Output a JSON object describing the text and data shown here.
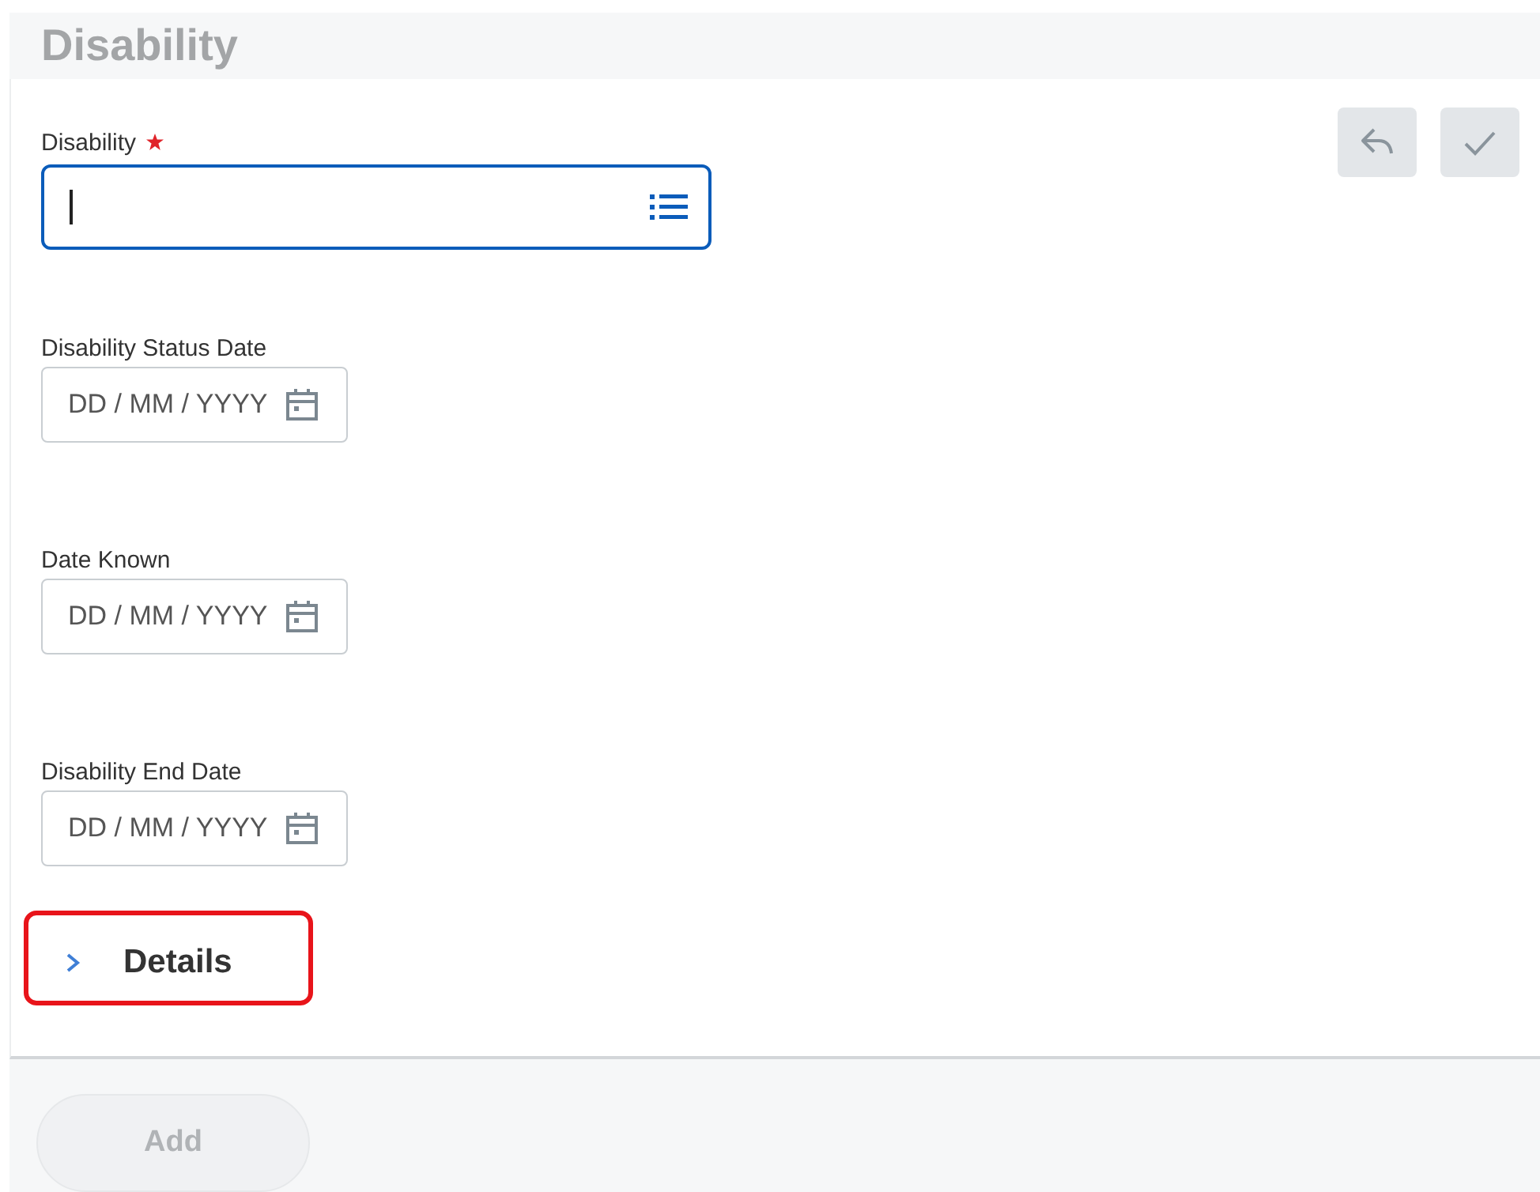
{
  "header": {
    "title": "Disability"
  },
  "actions": [
    {
      "kind": "undo",
      "disabled": true
    },
    {
      "kind": "confirm",
      "disabled": true
    }
  ],
  "fields": [
    {
      "kind": "prompt",
      "label": "Disability",
      "required": true,
      "focused": true
    },
    {
      "kind": "date",
      "label": "Disability Status Date",
      "required": false,
      "placeholder": "DD / MM / YYYY"
    },
    {
      "kind": "date",
      "label": "Date Known",
      "required": false,
      "placeholder": "DD / MM / YYYY"
    },
    {
      "kind": "date",
      "label": "Disability End Date",
      "required": false,
      "placeholder": "DD / MM / YYYY"
    }
  ],
  "section": {
    "label": "Details",
    "expanded": false,
    "highlighted": true
  },
  "footer": {
    "button": {
      "label": "Add",
      "disabled": true
    }
  }
}
